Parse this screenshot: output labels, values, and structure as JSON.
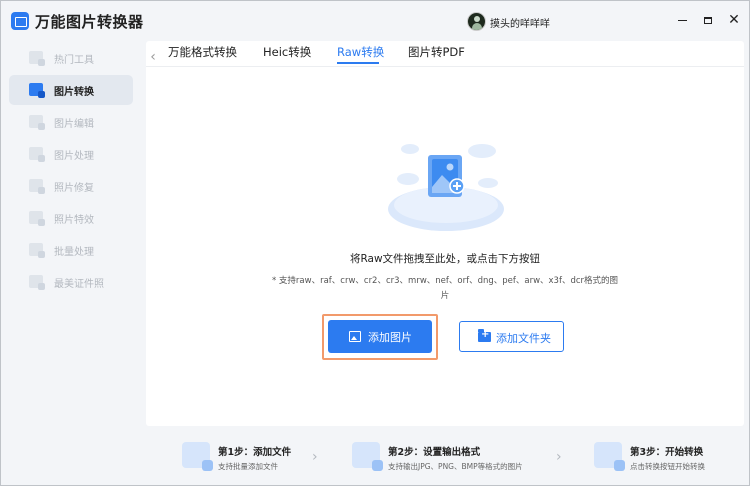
{
  "app": {
    "title": "万能图片转换器",
    "username": "摸头的咩咩咩"
  },
  "window": {
    "minimize_icon": "minimize-icon",
    "maximize_icon": "maximize-icon",
    "close_icon": "close-icon",
    "close_glyph": "✕"
  },
  "sidebar": {
    "items": [
      {
        "label": "热门工具",
        "icon": "hot-tools-icon",
        "active": false
      },
      {
        "label": "图片转换",
        "icon": "image-convert-icon",
        "active": true
      },
      {
        "label": "图片编辑",
        "icon": "image-edit-icon",
        "active": false
      },
      {
        "label": "图片处理",
        "icon": "image-process-icon",
        "active": false
      },
      {
        "label": "照片修复",
        "icon": "photo-repair-icon",
        "active": false
      },
      {
        "label": "照片特效",
        "icon": "photo-effect-icon",
        "active": false
      },
      {
        "label": "批量处理",
        "icon": "batch-process-icon",
        "active": false
      },
      {
        "label": "最美证件照",
        "icon": "id-photo-icon",
        "active": false
      }
    ]
  },
  "tabs": {
    "back_glyph": "‹",
    "items": [
      {
        "label": "万能格式转换",
        "active": false
      },
      {
        "label": "Heic转换",
        "active": false
      },
      {
        "label": "Raw转换",
        "active": true
      },
      {
        "label": "图片转PDF",
        "active": false
      }
    ]
  },
  "drop": {
    "hint": "将Raw文件拖拽至此处，或点击下方按钮",
    "formats_line1": "* 支持raw、raf、crw、cr2、cr3、mrw、nef、orf、dng、pef、arw、x3f、dcr格式的图",
    "formats_line2": "片"
  },
  "buttons": {
    "add_image": "添加图片",
    "add_folder": "添加文件夹"
  },
  "steps": [
    {
      "title": "第1步：添加文件",
      "desc": "支持批量添加文件"
    },
    {
      "title": "第2步：设置输出格式",
      "desc": "支持输出JPG、PNG、BMP等格式的图片"
    },
    {
      "title": "第3步：开始转换",
      "desc": "点击转换按钮开始转换"
    }
  ],
  "step_arrow": "›",
  "colors": {
    "accent": "#2c7bf0",
    "focus_outline": "#f29a6b",
    "sidebar_bg": "#f3f5f8"
  }
}
